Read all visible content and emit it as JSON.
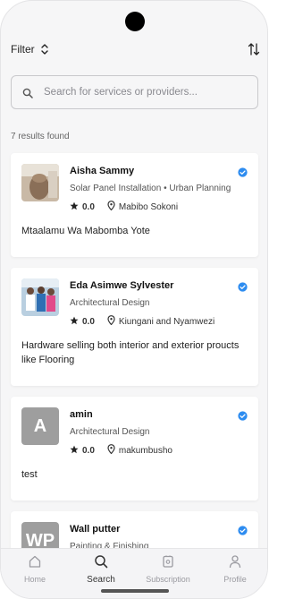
{
  "header": {
    "filter_label": "Filter",
    "filter_icon": "chevron-up-down-icon",
    "sort_icon": "sort-arrows-icon"
  },
  "search": {
    "placeholder": "Search for services or providers...",
    "value": "",
    "icon": "search-icon"
  },
  "results_text": "7 results found",
  "providers": [
    {
      "name": "Aisha Sammy",
      "category": "Solar Panel Installation • Urban Planning",
      "rating": "0.0",
      "location": "Mabibo Sokoni",
      "description": "Mtaalamu Wa Mabomba Yote",
      "avatar": "photo",
      "verified": true
    },
    {
      "name": "Eda Asimwe Sylvester",
      "category": "Architectural Design",
      "rating": "0.0",
      "location": "Kiungani and Nyamwezi",
      "description": "Hardware selling both interior and exterior proucts like Flooring",
      "avatar": "photo",
      "verified": true
    },
    {
      "name": "amin",
      "category": "Architectural Design",
      "rating": "0.0",
      "location": "makumbusho",
      "description": "test",
      "avatar": "A",
      "verified": true
    },
    {
      "name": "Wall putter",
      "category": "Painting & Finishing",
      "avatar": "WP",
      "verified": true
    }
  ],
  "nav": [
    {
      "label": "Home",
      "icon": "home-icon",
      "active": false
    },
    {
      "label": "Search",
      "icon": "search-icon",
      "active": true
    },
    {
      "label": "Subscription",
      "icon": "subscription-icon",
      "active": false
    },
    {
      "label": "Profile",
      "icon": "profile-icon",
      "active": false
    }
  ],
  "colors": {
    "verified": "#2d8cf0",
    "avatar_placeholder": "#9e9e9e",
    "background": "#f6f6f7",
    "card": "#ffffff"
  }
}
